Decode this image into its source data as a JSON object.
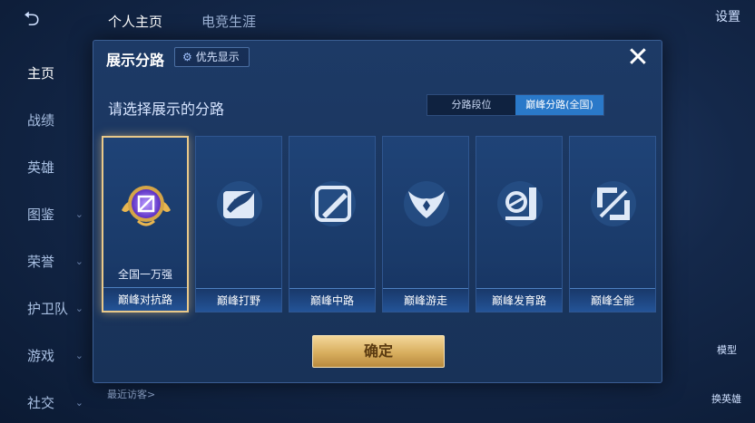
{
  "topbar": {
    "back_icon": "back-arrow-icon",
    "tabs": [
      "个人主页",
      "电竞生涯"
    ],
    "settings_label": "设置"
  },
  "sidebar": {
    "items": [
      {
        "label": "主页"
      },
      {
        "label": "战绩"
      },
      {
        "label": "英雄"
      },
      {
        "label": "图鉴"
      },
      {
        "label": "荣誉"
      },
      {
        "label": "护卫队"
      },
      {
        "label": "游戏"
      },
      {
        "label": "社交"
      }
    ]
  },
  "background": {
    "recent_visitors": "最近访客>",
    "model_label": "模型",
    "change_hero_label": "换英雄"
  },
  "modal": {
    "title": "展示分路",
    "priority_label": "优先显示",
    "close_icon": "close-x-icon",
    "prompt": "请选择展示的分路",
    "toggle_options": [
      "分路段位",
      "巅峰分路(全国)"
    ],
    "selected_toggle": "巅峰分路(全国)",
    "cards": [
      {
        "label": "巅峰对抗路",
        "rank": "全国一万强",
        "icon": "sword-emblem-icon",
        "selected": true
      },
      {
        "label": "巅峰打野",
        "icon": "dragon-icon",
        "selected": false
      },
      {
        "label": "巅峰中路",
        "icon": "slash-icon",
        "selected": false
      },
      {
        "label": "巅峰游走",
        "icon": "wings-shield-icon",
        "selected": false
      },
      {
        "label": "巅峰发育路",
        "icon": "target-bow-icon",
        "selected": false
      },
      {
        "label": "巅峰全能",
        "icon": "double-slash-icon",
        "selected": false
      }
    ],
    "confirm_label": "确定"
  },
  "colors": {
    "accent_gold": "#e9c98a",
    "toggle_active": "#2a79c9",
    "card_bg": "#1f4377"
  }
}
